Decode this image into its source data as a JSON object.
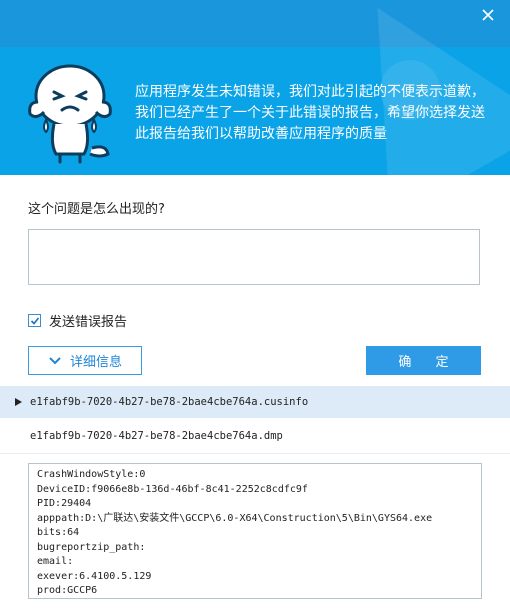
{
  "header": {
    "message": "应用程序发生未知错误，我们对此引起的不便表示道歉，我们已经产生了一个关于此错误的报告，希望你选择发送此报告给我们以帮助改善应用程序的质量"
  },
  "form": {
    "question": "这个问题是怎么出现的?",
    "description_value": "",
    "send_report_label": "发送错误报告",
    "send_report_checked": true,
    "details_button": "详细信息",
    "ok_button": "确 定"
  },
  "files": [
    {
      "name": "e1fabf9b-7020-4b27-be78-2bae4cbe764a.cusinfo",
      "selected": true
    },
    {
      "name": "e1fabf9b-7020-4b27-be78-2bae4cbe764a.dmp",
      "selected": false
    }
  ],
  "file_content": [
    "CrashWindowStyle:0",
    "DeviceID:f9066e8b-136d-46bf-8c41-2252c8cdfc9f",
    "PID:29404",
    "apppath:D:\\广联达\\安装文件\\GCCP\\6.0-X64\\Construction\\5\\Bin\\GYS64.exe",
    "bits:64",
    "bugreportzip_path:",
    "email:",
    "exever:6.4100.5.129",
    "prod:GCCP6"
  ],
  "icons": {
    "close": "close-icon",
    "mascot": "crying-mascot-icon",
    "check": "checkmark-icon",
    "chevron": "chevron-down-icon",
    "expand": "triangle-right-icon"
  },
  "colors": {
    "header_bg": "#0aa3e8",
    "topbar_bg": "#1996dc",
    "accent": "#2f9ae6",
    "selected_row": "#dcebf7"
  }
}
